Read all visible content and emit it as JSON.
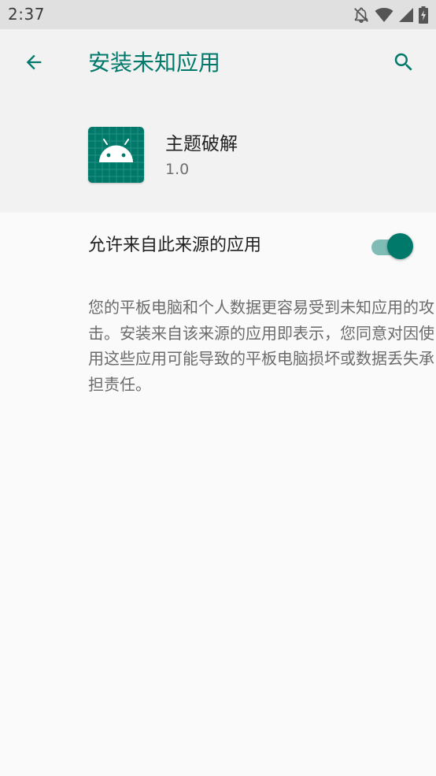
{
  "status_bar": {
    "time": "2:37",
    "icons": [
      "notifications-off-icon",
      "wifi-icon",
      "cell-signal-icon",
      "battery-charging-icon"
    ]
  },
  "app_bar": {
    "title": "安装未知应用",
    "back_icon": "arrow-back-icon",
    "search_icon": "search-icon"
  },
  "app_header": {
    "icon": "android-app-icon",
    "name": "主题破解",
    "version": "1.0"
  },
  "setting": {
    "label": "允许来自此来源的应用",
    "enabled": true
  },
  "description": "您的平板电脑和个人数据更容易受到未知应用的攻击。安装来自该来源的应用即表示，您同意对因使用这些应用可能导致的平板电脑损坏或数据丢失承担责任。",
  "colors": {
    "accent": "#00796b",
    "toggle_track": "#7fbcb5",
    "header_bg": "#f2f2f2",
    "page_bg": "#fafafa",
    "status_bar_bg": "#e0e0e0"
  }
}
